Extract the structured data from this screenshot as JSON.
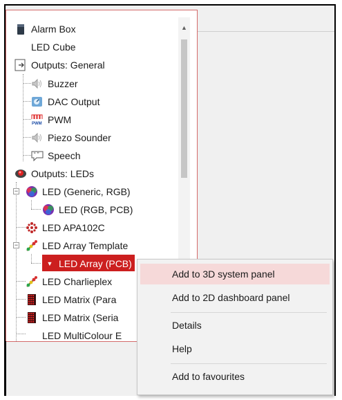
{
  "tree": {
    "items": [
      {
        "label": "Alarm Box",
        "icon": "alarm-box-icon"
      },
      {
        "label": "LED Cube",
        "icon": ""
      },
      {
        "label": "Outputs: General",
        "icon": "outputs-general-icon"
      },
      {
        "label": "Buzzer",
        "icon": "speaker-icon"
      },
      {
        "label": "DAC Output",
        "icon": "dac-icon"
      },
      {
        "label": "PWM",
        "icon": "pwm-icon"
      },
      {
        "label": "Piezo Sounder",
        "icon": "speaker-icon"
      },
      {
        "label": "Speech",
        "icon": "speech-icon"
      },
      {
        "label": "Outputs: LEDs",
        "icon": "leds-category-icon"
      },
      {
        "label": "LED (Generic, RGB)",
        "icon": "rgb-led-icon"
      },
      {
        "label": "LED (RGB, PCB)",
        "icon": "rgb-led-icon"
      },
      {
        "label": "LED APA102C",
        "icon": "apa102c-icon"
      },
      {
        "label": "LED Array Template",
        "icon": "led-array-icon"
      },
      {
        "label": "LED Array (PCB)",
        "icon": "dropdown-arrow-icon"
      },
      {
        "label": "LED Charlieplex",
        "icon": "led-array-icon"
      },
      {
        "label": "LED Matrix (Para",
        "icon": "led-matrix-icon"
      },
      {
        "label": "LED Matrix (Seria",
        "icon": "led-matrix-icon"
      },
      {
        "label": "LED MultiColour E",
        "icon": ""
      }
    ]
  },
  "context_menu": {
    "items": [
      "Add to 3D system panel",
      "Add to 2D dashboard panel",
      "Details",
      "Help",
      "Add to favourites"
    ]
  },
  "colors": {
    "selected_bg": "#cc1f1f",
    "menu_highlight": "#f6d9d9",
    "panel_border": "#d46a6a"
  }
}
